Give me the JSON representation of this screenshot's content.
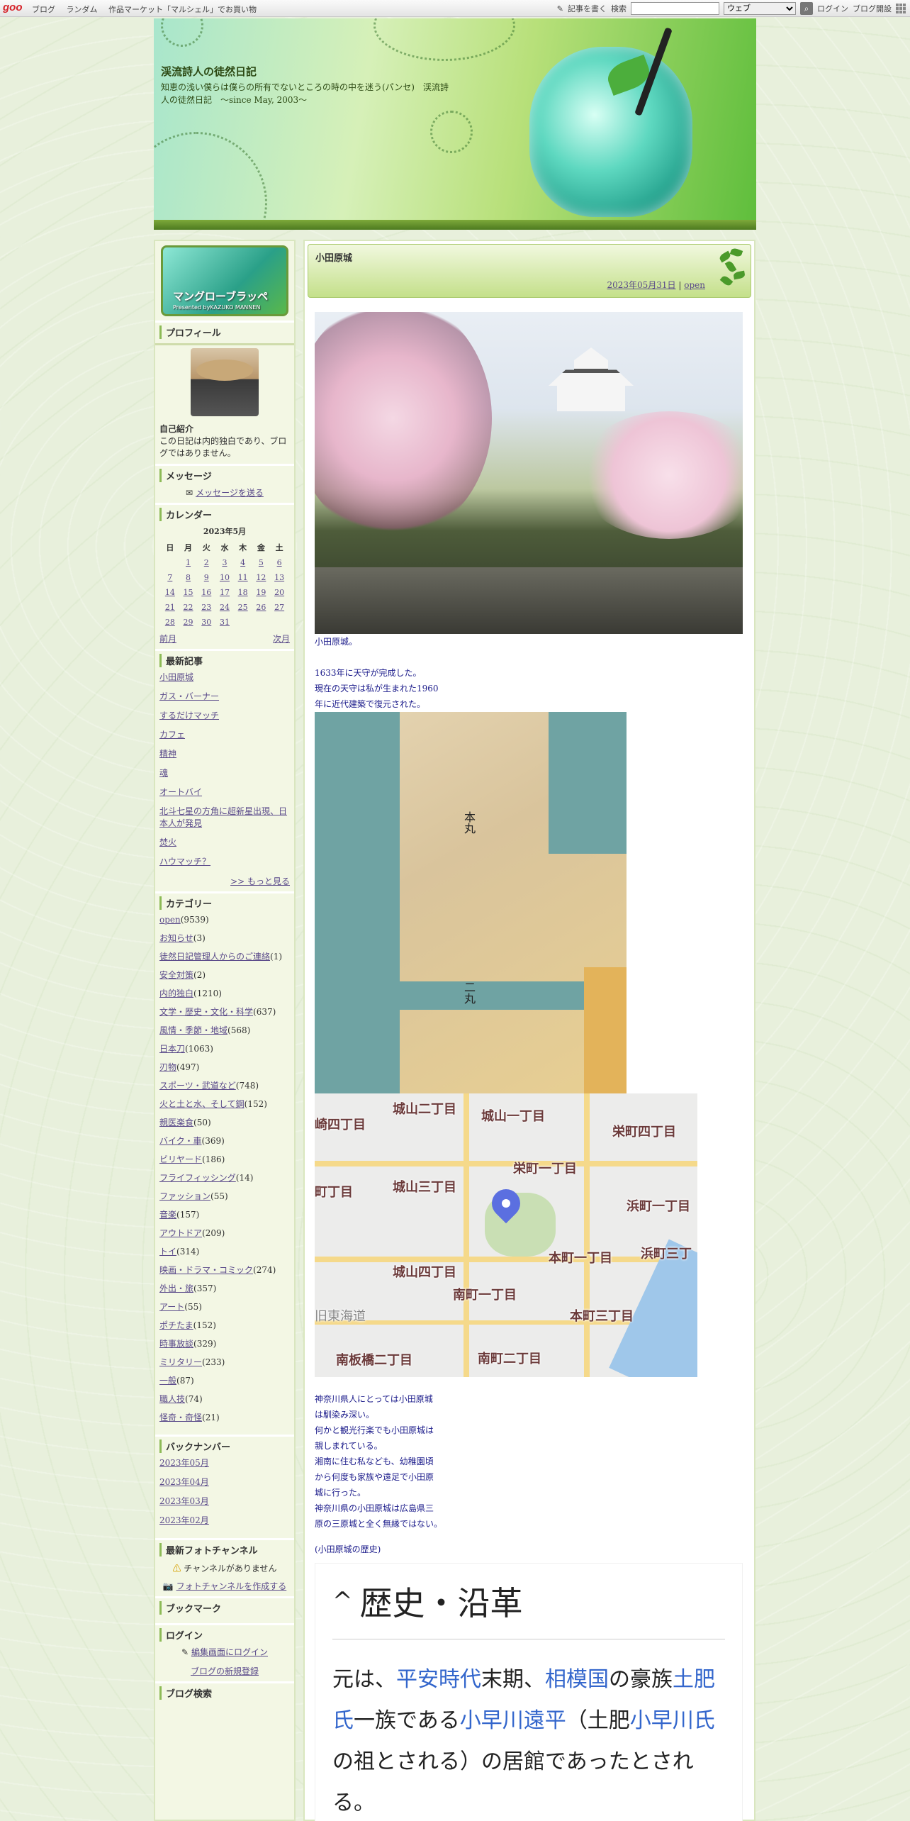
{
  "topbar": {
    "logo": "goo",
    "nav": [
      "ブログ",
      "ランダム",
      "作品マーケット「マルシェル」でお買い物"
    ],
    "write": "記事を書く",
    "search_label": "検索",
    "search_value": "",
    "search_scope": "ウェブ",
    "login": "ログイン",
    "blog_open": "ブログ開設"
  },
  "header": {
    "title": "渓流詩人の徒然日記",
    "description": "知恵の浅い僕らは僕らの所有でないところの時の中を迷う(パンセ)　渓流詩人の徒然日記　～since May, 2003～"
  },
  "sidebar": {
    "banner": {
      "line1": "マングローブラッペ",
      "line2": "Presented byKAZUKO MANNEN"
    },
    "profile": {
      "title": "プロフィール",
      "intro_label": "自己紹介",
      "intro_text": "この日記は内的独白であり、ブログではありません。"
    },
    "message": {
      "title": "メッセージ",
      "link": "メッセージを送る"
    },
    "calendar": {
      "title": "カレンダー",
      "month": "2023年5月",
      "weekdays": [
        "日",
        "月",
        "火",
        "水",
        "木",
        "金",
        "土"
      ],
      "weeks": [
        [
          "",
          "1",
          "2",
          "3",
          "4",
          "5",
          "6"
        ],
        [
          "7",
          "8",
          "9",
          "10",
          "11",
          "12",
          "13"
        ],
        [
          "14",
          "15",
          "16",
          "17",
          "18",
          "19",
          "20"
        ],
        [
          "21",
          "22",
          "23",
          "24",
          "25",
          "26",
          "27"
        ],
        [
          "28",
          "29",
          "30",
          "31",
          "",
          "",
          ""
        ]
      ],
      "prev": "前月",
      "next": "次月"
    },
    "recent": {
      "title": "最新記事",
      "items": [
        "小田原城",
        "ガス・バーナー",
        "するだけマッチ",
        "カフェ",
        "精神",
        "魂",
        "オートバイ",
        "北斗七星の方角に超新星出現、日本人が発見",
        "焚火",
        "ハウマッチ？"
      ],
      "more": ">> もっと見る"
    },
    "categories": {
      "title": "カテゴリー",
      "items": [
        {
          "name": "open",
          "count": "(9539)"
        },
        {
          "name": "お知らせ",
          "count": "(3)"
        },
        {
          "name": "徒然日記管理人からのご連絡",
          "count": "(1)"
        },
        {
          "name": "安全対策",
          "count": "(2)"
        },
        {
          "name": "内的独白",
          "count": "(1210)"
        },
        {
          "name": "文学・歴史・文化・科学",
          "count": "(637)"
        },
        {
          "name": "風情・季節・地域",
          "count": "(568)"
        },
        {
          "name": "日本刀",
          "count": "(1063)"
        },
        {
          "name": "刃物",
          "count": "(497)"
        },
        {
          "name": "スポーツ・武道など",
          "count": "(748)"
        },
        {
          "name": "火と土と水、そして鋼",
          "count": "(152)"
        },
        {
          "name": "親医楽食",
          "count": "(50)"
        },
        {
          "name": "バイク・車",
          "count": "(369)"
        },
        {
          "name": "ビリヤード",
          "count": "(186)"
        },
        {
          "name": "フライフィッシング",
          "count": "(14)"
        },
        {
          "name": "ファッション",
          "count": "(55)"
        },
        {
          "name": "音楽",
          "count": "(157)"
        },
        {
          "name": "アウトドア",
          "count": "(209)"
        },
        {
          "name": "トイ",
          "count": "(314)"
        },
        {
          "name": "映画・ドラマ・コミック",
          "count": "(274)"
        },
        {
          "name": "外出・旅",
          "count": "(357)"
        },
        {
          "name": "アート",
          "count": "(55)"
        },
        {
          "name": "ポチたま",
          "count": "(152)"
        },
        {
          "name": "時事放談",
          "count": "(329)"
        },
        {
          "name": "ミリタリー",
          "count": "(233)"
        },
        {
          "name": "一般",
          "count": "(87)"
        },
        {
          "name": "職人技",
          "count": "(74)"
        },
        {
          "name": "怪奇・奇怪",
          "count": "(21)"
        }
      ]
    },
    "backnumber": {
      "title": "バックナンバー",
      "items": [
        "2023年05月",
        "2023年04月",
        "2023年03月",
        "2023年02月"
      ]
    },
    "photo": {
      "title": "最新フォトチャンネル",
      "empty": "チャンネルがありません",
      "create": "フォトチャンネルを作成する"
    },
    "bookmark": {
      "title": "ブックマーク"
    },
    "login": {
      "title": "ログイン",
      "edit": "編集画面にログイン",
      "register": "ブログの新規登録"
    },
    "next_title": "ブログ検索"
  },
  "entry": {
    "title": "小田原城",
    "date": "2023年05月31日",
    "sep": "|",
    "category": "open",
    "caption1": "小田原城。",
    "para1": [
      "1633年に天守が完成した。",
      "現在の天守は私が生まれた1960",
      "年に近代建築で復元された。"
    ],
    "map1_labels": [
      "本丸",
      "二丸"
    ],
    "map2_labels": [
      "城山二丁目",
      "城山一丁目",
      "栄町四丁目",
      "栄町一丁目",
      "城山三丁目",
      "浜町一丁目",
      "本町一丁目",
      "浜町三丁",
      "城山四丁目",
      "南町一丁目",
      "本町三丁目",
      "南板橋二丁目",
      "南町二丁目",
      "旧東海道"
    ],
    "para2": [
      "神奈川県人にとっては小田原城",
      "は馴染み深い。",
      "何かと観光行楽でも小田原城は",
      "親しまれている。",
      "湘南に住む私なども、幼稚園頃",
      "から何度も家族や遠足で小田原",
      "城に行った。",
      "神奈川県の小田原城は広島県三",
      "原の三原城と全く無縁ではない。"
    ],
    "history_label": "(小田原城の歴史)",
    "wiki": {
      "heading": "歴史・沿革",
      "text": [
        {
          "t": "元は、",
          "link": false
        },
        {
          "t": "平安時代",
          "link": true
        },
        {
          "t": "末期、",
          "link": false
        },
        {
          "t": "相模国",
          "link": true
        },
        {
          "t": "の豪族",
          "link": false
        },
        {
          "t": "土肥氏",
          "link": true
        },
        {
          "t": "一族である",
          "link": false
        },
        {
          "t": "小早川遠平",
          "link": true
        },
        {
          "t": "（土肥",
          "link": false
        },
        {
          "t": "小早川氏",
          "link": true
        },
        {
          "t": "の祖とされる）の居館であったとされる。",
          "link": false
        }
      ]
    }
  }
}
